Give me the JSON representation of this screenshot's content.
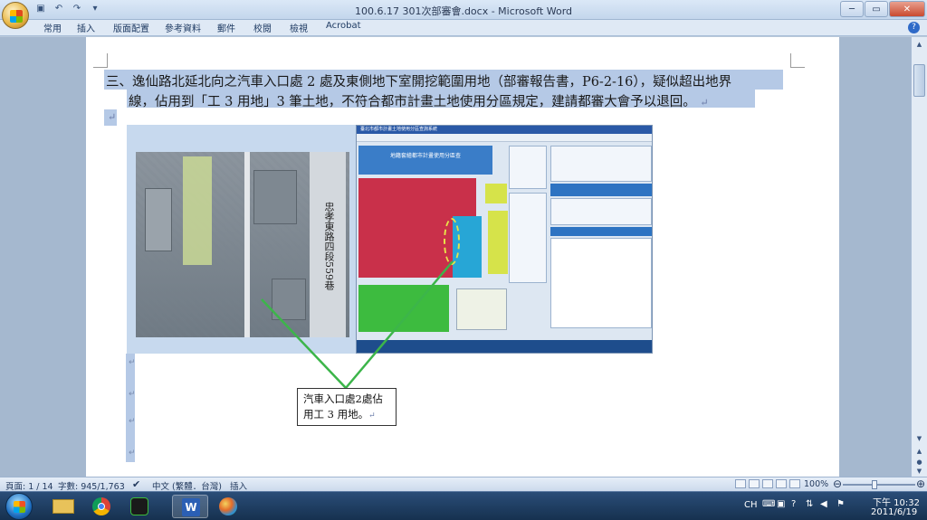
{
  "window": {
    "title": "100.6.17 301次部審會.docx - Microsoft Word",
    "controls": [
      "─",
      "▭",
      "✕"
    ]
  },
  "ribbon": {
    "tabs": [
      "常用",
      "插入",
      "版面配置",
      "參考資料",
      "郵件",
      "校閱",
      "檢視",
      "Acrobat"
    ]
  },
  "document": {
    "para_line1": "三、逸仙路北延北向之汽車入口處 2 處及東側地下室開挖範圍用地（部審報告書，P6-2-16），疑似超出地界",
    "para_line2": "線，佔用到「工 3 用地」3 筆土地，不符合都市計畫土地使用分區規定，建請都審大會予以退回。",
    "para_mark": "↵",
    "map_road_label": "忠孝東路四段559巷",
    "callout_line1": "汽車入口處2處佔",
    "callout_line2": "用工 3 用地。",
    "screen_title": "臺北市都市計畫土地使用分區查詢系統",
    "screen_banner": "地籍套繪都市計畫使用分區查"
  },
  "statusbar": {
    "page": "頁面: 1 / 14",
    "words": "字數: 945/1,763",
    "language": "中文 (繁體．台灣)",
    "mode": "插入",
    "zoom": "100%"
  },
  "taskbar": {
    "ime": "CH",
    "time": "下午 10:32",
    "date": "2011/6/19"
  },
  "colors": {
    "zone_red": "#c9304a",
    "zone_green": "#3dbb3f",
    "zone_blue": "#27a6d6",
    "zone_yellow": "#d6e34a",
    "callout_line": "#3cb54a"
  }
}
